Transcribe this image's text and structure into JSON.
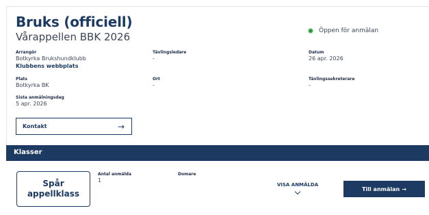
{
  "event": {
    "title": "Bruks (officiell)",
    "subtitle": "Vårappellen BBK 2026",
    "status_text": "Öppen för anmälan",
    "status_color": "#2e9b3a"
  },
  "details": {
    "organizer_label": "Arrangör",
    "organizer_value": "Botkyrka Brukshundklubb",
    "club_link": "Klubbens webbplats",
    "competition_leader_label": "Tävlingsledare",
    "competition_leader_value": "-",
    "date_label": "Datum",
    "date_value": "26 apr. 2026",
    "location_label": "Plats",
    "location_value": "Botkyrka BK",
    "city_label": "Ort",
    "city_value": "-",
    "secretary_label": "Tävlingssekreterare",
    "secretary_value": "-",
    "deadline_label": "Sista anmälningsdag",
    "deadline_value": "5 apr. 2026"
  },
  "contact": {
    "label": "Kontakt",
    "arrow": "→"
  },
  "classes": {
    "section_title": "Klasser",
    "items": [
      {
        "name_line1": "Spår",
        "name_line2": "appellklass",
        "entries_label": "Antal anmälda",
        "entries_value": "1",
        "judge_label": "Domare",
        "show_entries_label": "VISA ANMÄLDA",
        "apply_label": "Till anmälan",
        "apply_arrow": "→"
      }
    ]
  },
  "colors": {
    "brand_navy": "#1d3a63",
    "status_green": "#2e9b3a"
  }
}
